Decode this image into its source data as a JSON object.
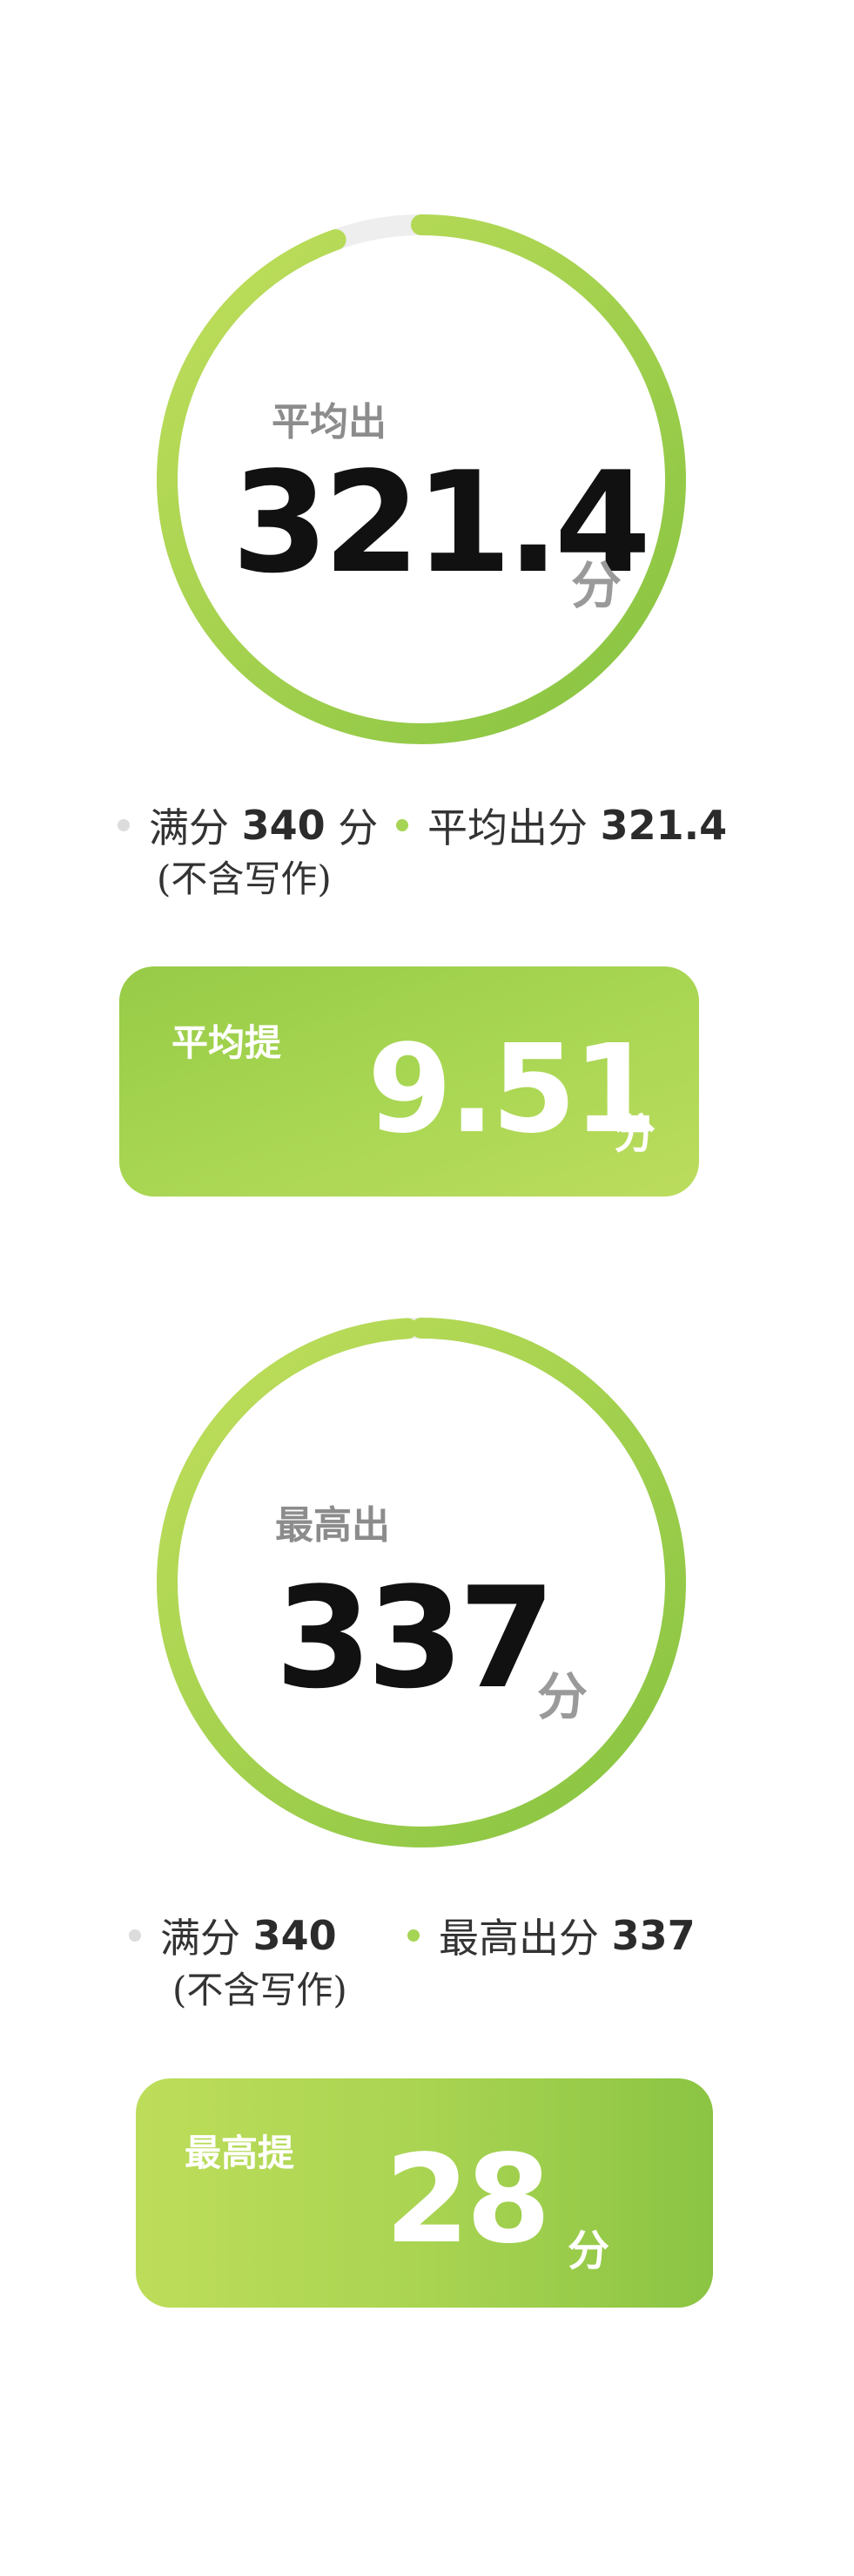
{
  "avg": {
    "ring_label": "平均出",
    "ring_value": "321.4",
    "ring_unit": "分",
    "ring_progress": 0.9453,
    "legend_full_prefix": "满分",
    "legend_full_value": "340",
    "legend_full_suffix": "分",
    "legend_full_note": "(不含写作)",
    "legend_score_prefix": "平均出分",
    "legend_score_value": "321.4",
    "card_label": "平均提",
    "card_value": "9.51",
    "card_unit": "分"
  },
  "max": {
    "ring_label": "最高出",
    "ring_value": "337",
    "ring_unit": "分",
    "ring_progress": 0.9912,
    "legend_full_prefix": "满分",
    "legend_full_value": "340",
    "legend_full_note": "(不含写作)",
    "legend_score_prefix": "最高出分",
    "legend_score_value": "337",
    "card_label": "最高提",
    "card_value": "28",
    "card_unit": "分"
  },
  "colors": {
    "track": "#eeeeee",
    "ring_start": "#bddd5a",
    "ring_end": "#88c442",
    "accent_dot": "#a6d455",
    "neutral_dot": "#dcdcdc"
  }
}
